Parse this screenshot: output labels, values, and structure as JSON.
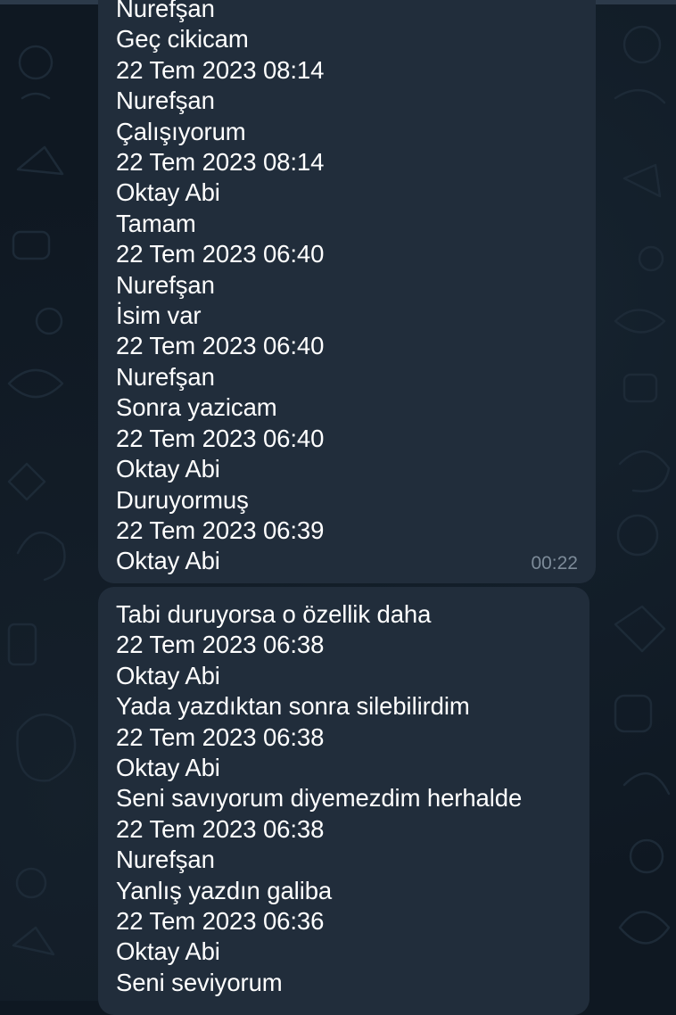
{
  "chat": {
    "messages": [
      {
        "lines": [
          "Nurefşan",
          "Geç cikicam",
          "22 Tem 2023 08:14",
          "Nurefşan",
          "Çalışıyorum",
          "22 Tem 2023 08:14",
          "Oktay Abi",
          "Tamam",
          "22 Tem 2023 06:40",
          "Nurefşan",
          "İsim var",
          "22 Tem 2023 06:40",
          "Nurefşan",
          "Sonra yazicam",
          "22 Tem 2023 06:40",
          "Oktay Abi",
          "Duruyormuş",
          "22 Tem 2023 06:39",
          "Oktay Abi"
        ],
        "time": "00:22"
      },
      {
        "lines": [
          "Tabi duruyorsa o özellik daha",
          "22 Tem 2023 06:38",
          "Oktay Abi",
          "Yada yazdıktan sonra silebilirdim",
          "22 Tem 2023 06:38",
          "Oktay Abi",
          "Seni savıyorum diyemezdim herhalde",
          "22 Tem 2023 06:38",
          "Nurefşan",
          "Yanlış yazdın galiba",
          "22 Tem 2023 06:36",
          "Oktay Abi",
          "Seni seviyorum"
        ],
        "time": ""
      }
    ]
  },
  "colors": {
    "background": "#0f1822",
    "bubble": "#212d3b",
    "text": "#ffffff",
    "time": "#7d8b99"
  }
}
